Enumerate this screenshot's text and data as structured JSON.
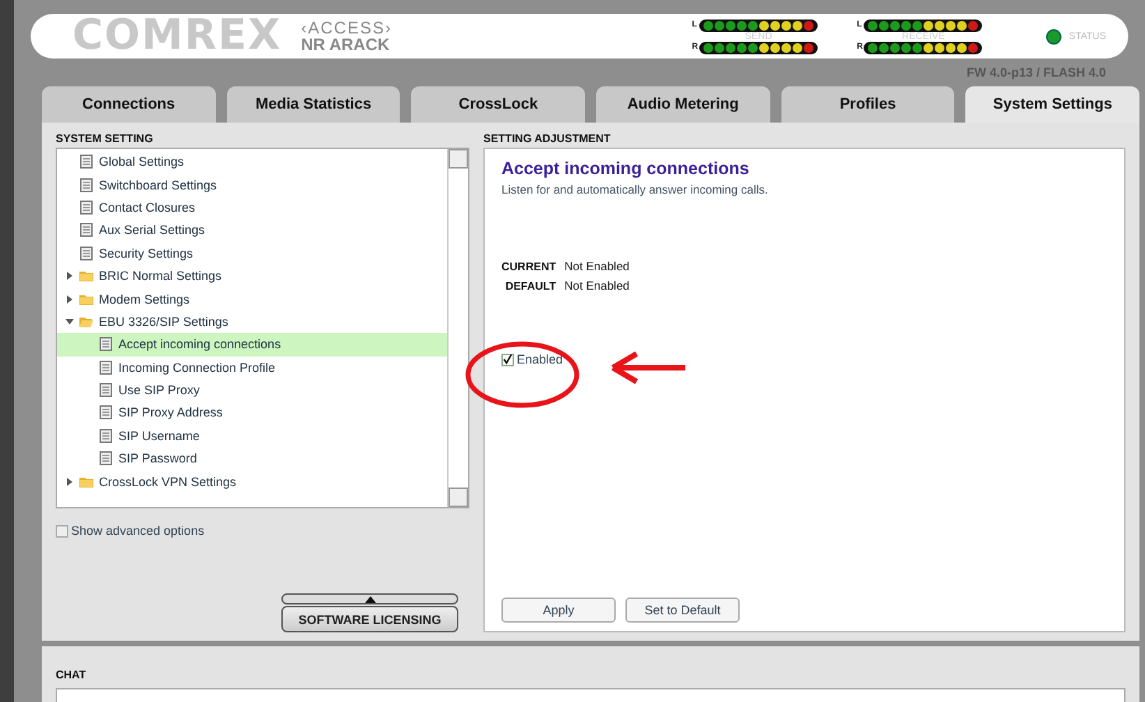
{
  "header": {
    "logo": "COMREX",
    "product": "‹ACCESS›",
    "device": "NR ARACK",
    "meters": [
      {
        "label": "SEND",
        "channels": [
          "L",
          "R"
        ]
      },
      {
        "label": "RECEIVE",
        "channels": [
          "L",
          "R"
        ]
      }
    ],
    "status": "STATUS",
    "firmware": "FW 4.0-p13 / FLASH 4.0"
  },
  "tabs": [
    {
      "label": "Connections",
      "selected": false
    },
    {
      "label": "Media Statistics",
      "selected": false
    },
    {
      "label": "CrossLock",
      "selected": false
    },
    {
      "label": "Audio Metering",
      "selected": false
    },
    {
      "label": "Profiles",
      "selected": false
    },
    {
      "label": "System Settings",
      "selected": true
    }
  ],
  "sidebar": {
    "title": "SYSTEM SETTING",
    "items": [
      {
        "label": "Global Settings",
        "kind": "page",
        "selected": false
      },
      {
        "label": "Switchboard Settings",
        "kind": "page",
        "selected": false
      },
      {
        "label": "Contact Closures",
        "kind": "page",
        "selected": false
      },
      {
        "label": "Aux Serial Settings",
        "kind": "page",
        "selected": false
      },
      {
        "label": "Security Settings",
        "kind": "page",
        "selected": false
      },
      {
        "label": "BRIC Normal Settings",
        "kind": "folder",
        "expanded": false,
        "selected": false
      },
      {
        "label": "Modem Settings",
        "kind": "folder",
        "expanded": false,
        "selected": false
      },
      {
        "label": "EBU 3326/SIP Settings",
        "kind": "folder",
        "expanded": true,
        "selected": false,
        "children": [
          {
            "label": "Accept incoming connections",
            "kind": "page",
            "selected": true
          },
          {
            "label": "Incoming Connection Profile",
            "kind": "page",
            "selected": false
          },
          {
            "label": "Use SIP Proxy",
            "kind": "page",
            "selected": false
          },
          {
            "label": "SIP Proxy Address",
            "kind": "page",
            "selected": false
          },
          {
            "label": "SIP Username",
            "kind": "page",
            "selected": false
          },
          {
            "label": "SIP Password",
            "kind": "page",
            "selected": false
          }
        ]
      },
      {
        "label": "CrossLock VPN Settings",
        "kind": "folder",
        "expanded": false,
        "selected": false
      }
    ],
    "show_advanced": {
      "label": "Show advanced options",
      "checked": false
    },
    "software_licensing": "SOFTWARE LICENSING"
  },
  "setting": {
    "title": "SETTING ADJUSTMENT",
    "heading": "Accept incoming connections",
    "description": "Listen for and automatically answer incoming calls.",
    "current": {
      "label": "CURRENT",
      "value": "Not Enabled"
    },
    "default": {
      "label": "DEFAULT",
      "value": "Not Enabled"
    },
    "option": {
      "label": "Enabled",
      "checked": true
    },
    "buttons": [
      "Apply",
      "Set to Default"
    ]
  },
  "chat": {
    "title": "CHAT"
  }
}
